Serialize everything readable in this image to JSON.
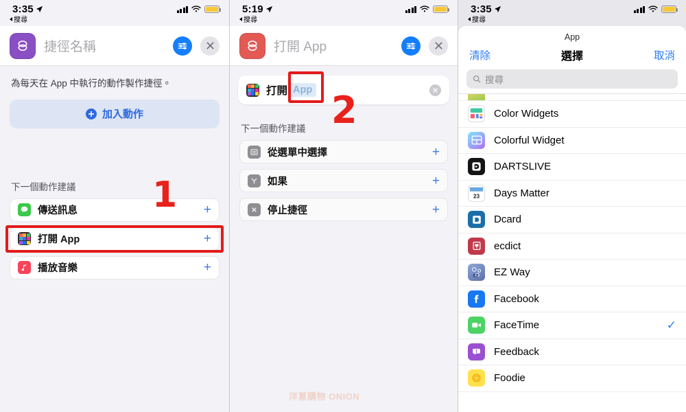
{
  "panels": {
    "left": {
      "status": {
        "time": "3:35",
        "back_label": "搜尋",
        "location_icon": "location-arrow-icon",
        "signal_icon": "cellular-bars-icon",
        "wifi_icon": "wifi-icon",
        "battery_icon": "battery-low-icon"
      },
      "header": {
        "icon": "shortcuts-app-icon",
        "name_placeholder": "捷徑名稱",
        "settings_icon": "sliders-icon",
        "close_icon": "close-x-icon"
      },
      "description": "為每天在 App 中執行的動作製作捷徑。",
      "add_action_label": "加入動作",
      "add_action_icon": "plus-circle-icon",
      "suggestions_title": "下一個動作建議",
      "suggestions": [
        {
          "label": "傳送訊息",
          "icon": "messages-icon",
          "add_icon": "plus-icon"
        },
        {
          "label": "打開 App",
          "icon": "app-grid-icon",
          "add_icon": "plus-icon"
        },
        {
          "label": "播放音樂",
          "icon": "music-icon",
          "add_icon": "plus-icon"
        }
      ],
      "annotation": {
        "step": "1"
      }
    },
    "mid": {
      "status": {
        "time": "5:19",
        "back_label": "搜尋",
        "location_icon": "location-arrow-icon",
        "signal_icon": "cellular-bars-icon",
        "wifi_icon": "wifi-icon",
        "battery_icon": "battery-low-icon"
      },
      "header": {
        "icon": "shortcuts-app-icon",
        "name_placeholder": "打開 App",
        "settings_icon": "sliders-icon",
        "close_icon": "close-x-icon"
      },
      "action": {
        "icon": "app-grid-icon",
        "verb": "打開",
        "token": "App",
        "clear_icon": "clear-circle-icon"
      },
      "suggestions_title": "下一個動作建議",
      "suggestions": [
        {
          "label": "從選單中選擇",
          "icon": "menu-icon",
          "add_icon": "plus-icon"
        },
        {
          "label": "如果",
          "icon": "if-icon",
          "add_icon": "plus-icon"
        },
        {
          "label": "停止捷徑",
          "icon": "stop-icon",
          "add_icon": "plus-icon"
        }
      ],
      "annotation": {
        "step": "2"
      },
      "watermark": "洋蔥購物 ONION"
    },
    "right": {
      "status": {
        "time": "3:35",
        "back_label": "搜尋",
        "location_icon": "location-arrow-icon",
        "signal_icon": "cellular-bars-icon",
        "wifi_icon": "wifi-icon",
        "battery_icon": "battery-low-icon"
      },
      "sheet": {
        "title": "App",
        "clear_label": "清除",
        "heading": "選擇",
        "cancel_label": "取消",
        "search_placeholder": "搜尋",
        "search_icon": "search-icon",
        "apps": [
          {
            "name": "Color Widgets",
            "icon": "color-widgets-icon",
            "selected": false
          },
          {
            "name": "Colorful Widget",
            "icon": "colorful-widget-icon",
            "selected": false
          },
          {
            "name": "DARTSLIVE",
            "icon": "dartslive-icon",
            "selected": false
          },
          {
            "name": "Days Matter",
            "icon": "days-matter-icon",
            "selected": false
          },
          {
            "name": "Dcard",
            "icon": "dcard-icon",
            "selected": false
          },
          {
            "name": "ecdict",
            "icon": "ecdict-icon",
            "selected": false
          },
          {
            "name": "EZ Way",
            "icon": "ez-way-icon",
            "selected": false
          },
          {
            "name": "Facebook",
            "icon": "facebook-icon",
            "selected": false
          },
          {
            "name": "FaceTime",
            "icon": "facetime-icon",
            "selected": true
          },
          {
            "name": "Feedback",
            "icon": "feedback-icon",
            "selected": false
          },
          {
            "name": "Foodie",
            "icon": "foodie-icon",
            "selected": false
          }
        ],
        "check_icon": "checkmark-icon"
      }
    }
  },
  "colors": {
    "accent_blue": "#2e7df2",
    "annotation_red": "#e31b1b",
    "shortcut_purple": "#8a4fc4",
    "shortcut_red": "#e35a55"
  }
}
